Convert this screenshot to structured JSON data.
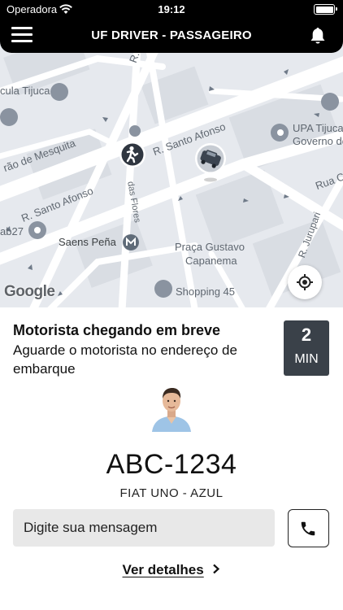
{
  "status_bar": {
    "carrier": "Operadora",
    "time": "19:12"
  },
  "header": {
    "title": "UF DRIVER - PASSAGEIRO"
  },
  "map": {
    "labels": {
      "street_mesquita": "rão de Mesquita",
      "street_santo_afonso_top": "R. Santo Afonso",
      "street_santo_afonso_left": "R. Santo Afonso",
      "street_das_flores": "das Flores",
      "street_rua_c": "Rua C",
      "street_jurupari": "R. Jurupari",
      "street_r_top": "R.",
      "poi_tijuca_left": "cula Tijuca",
      "poi_upa": "UPA Tijuca",
      "poi_governo": "Governo de",
      "poi_saens_pena": "Saens Peña",
      "poi_praca_1": "Praça Gustavo",
      "poi_praca_2": "Capanema",
      "poi_shopping": "Shopping 45",
      "poi_ab27": "ab27",
      "google": "Google"
    }
  },
  "ride": {
    "status_title": "Motorista chegando em breve",
    "status_subtitle": "Aguarde o motorista no endereço de embarque",
    "eta_value": "2",
    "eta_unit": "MIN",
    "plate": "ABC-1234",
    "car_model": "FIAT UNO - AZUL"
  },
  "message": {
    "placeholder": "Digite sua mensagem"
  },
  "details": {
    "label": "Ver detalhes"
  },
  "colors": {
    "eta_box": "#3a4149",
    "map_bg": "#e6e9ee",
    "header_bg": "#000000"
  },
  "icons": {
    "menu": "hamburger-icon",
    "bell": "bell-icon",
    "locate": "locate-icon",
    "call": "phone-icon",
    "chevron": "chevron-right-icon",
    "car": "car-icon",
    "passenger": "person-icon"
  }
}
